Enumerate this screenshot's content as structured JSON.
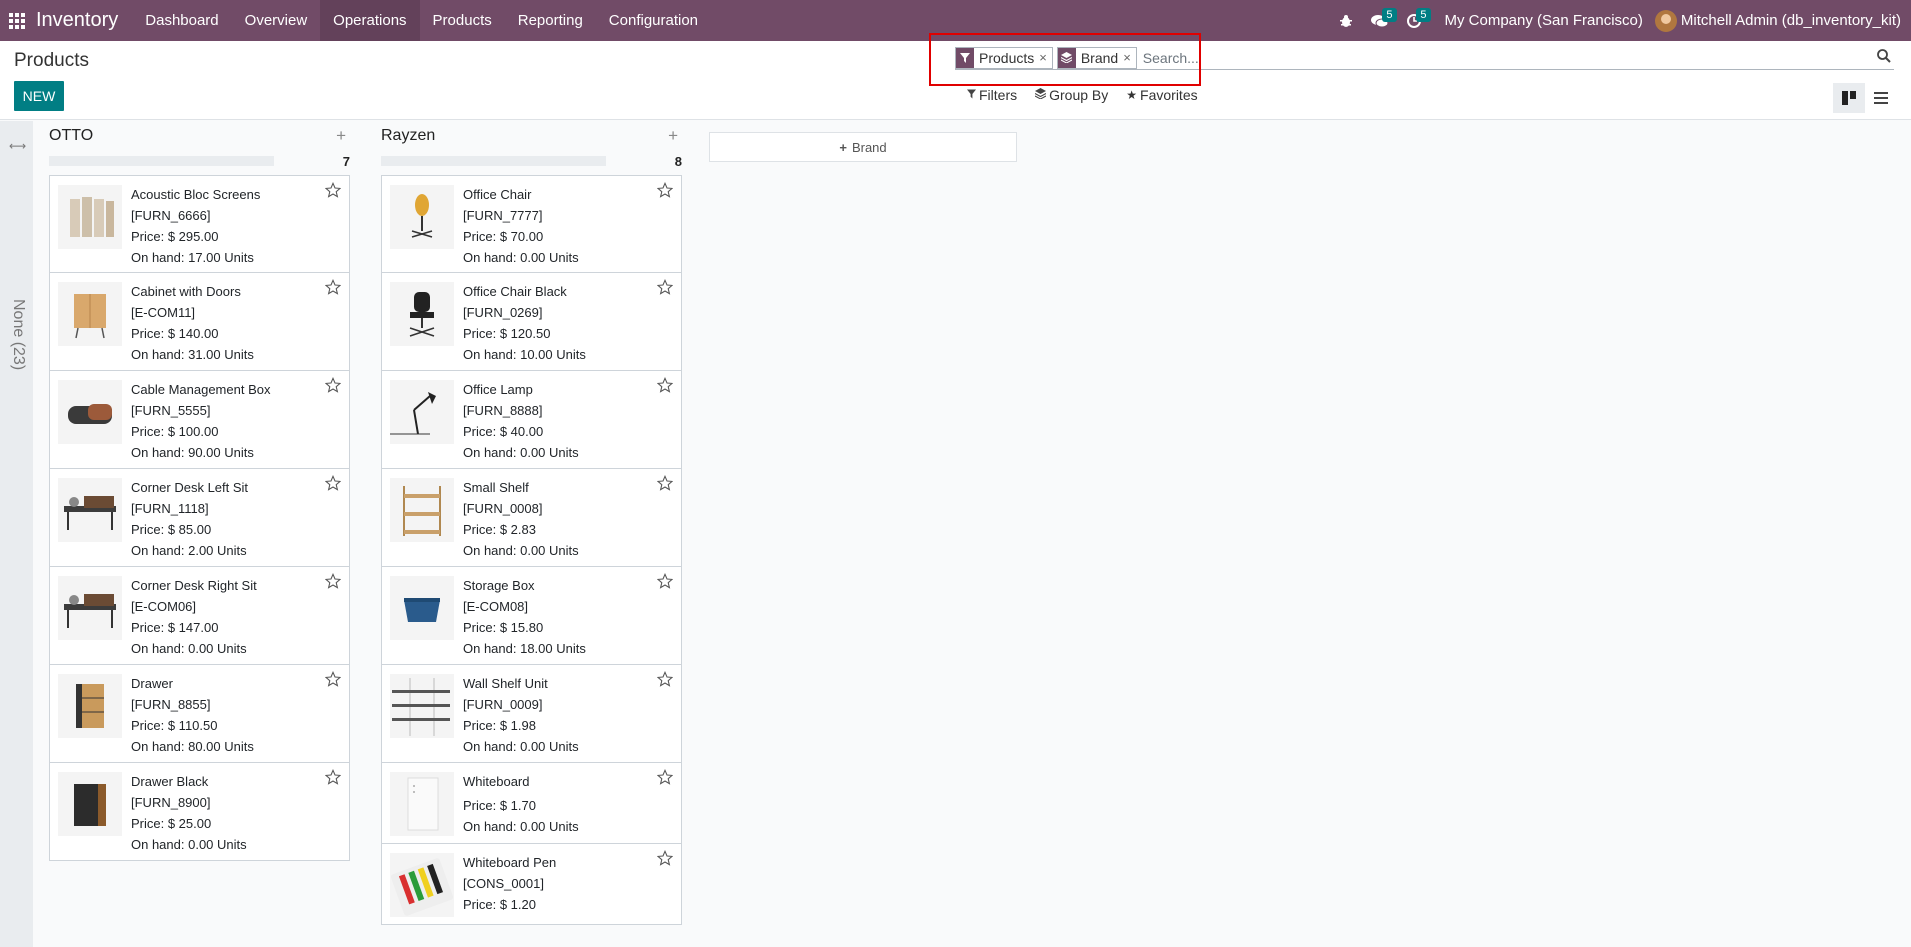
{
  "navbar": {
    "app_name": "Inventory",
    "menu": [
      "Dashboard",
      "Overview",
      "Operations",
      "Products",
      "Reporting",
      "Configuration"
    ],
    "active_menu": "Operations",
    "messages_count": "5",
    "activities_count": "5",
    "company": "My Company (San Francisco)",
    "user": "Mitchell Admin (db_inventory_kit)"
  },
  "control": {
    "title": "Products",
    "new_label": "NEW",
    "facets": [
      {
        "label": "Products",
        "icon": "filter-icon"
      },
      {
        "label": "Brand",
        "icon": "layers-icon"
      }
    ],
    "search_placeholder": "Search...",
    "filters_label": "Filters",
    "group_by_label": "Group By",
    "favorites_label": "Favorites"
  },
  "folded_column": {
    "label": "None (23)"
  },
  "add_column_label": "Brand",
  "columns": [
    {
      "name": "OTTO",
      "count": "7",
      "cards": [
        {
          "name": "Acoustic Bloc Screens",
          "ref": "[FURN_6666]",
          "price": "Price: $ 295.00",
          "onhand": "On hand: 17.00 Units",
          "img": "screens"
        },
        {
          "name": "Cabinet with Doors",
          "ref": "[E-COM11]",
          "price": "Price: $ 140.00",
          "onhand": "On hand: 31.00 Units",
          "img": "cabinet"
        },
        {
          "name": "Cable Management Box",
          "ref": "[FURN_5555]",
          "price": "Price: $ 100.00",
          "onhand": "On hand: 90.00 Units",
          "img": "cablebox"
        },
        {
          "name": "Corner Desk Left Sit",
          "ref": "[FURN_1118]",
          "price": "Price: $ 85.00",
          "onhand": "On hand: 2.00 Units",
          "img": "desk"
        },
        {
          "name": "Corner Desk Right Sit",
          "ref": "[E-COM06]",
          "price": "Price: $ 147.00",
          "onhand": "On hand: 0.00 Units",
          "img": "desk"
        },
        {
          "name": "Drawer",
          "ref": "[FURN_8855]",
          "price": "Price: $ 110.50",
          "onhand": "On hand: 80.00 Units",
          "img": "drawer"
        },
        {
          "name": "Drawer Black",
          "ref": "[FURN_8900]",
          "price": "Price: $ 25.00",
          "onhand": "On hand: 0.00 Units",
          "img": "drawerblack"
        }
      ]
    },
    {
      "name": "Rayzen",
      "count": "8",
      "cards": [
        {
          "name": "Office Chair",
          "ref": "[FURN_7777]",
          "price": "Price: $ 70.00",
          "onhand": "On hand: 0.00 Units",
          "img": "chair"
        },
        {
          "name": "Office Chair Black",
          "ref": "[FURN_0269]",
          "price": "Price: $ 120.50",
          "onhand": "On hand: 10.00 Units",
          "img": "chairblack"
        },
        {
          "name": "Office Lamp",
          "ref": "[FURN_8888]",
          "price": "Price: $ 40.00",
          "onhand": "On hand: 0.00 Units",
          "img": "lamp"
        },
        {
          "name": "Small Shelf",
          "ref": "[FURN_0008]",
          "price": "Price: $ 2.83",
          "onhand": "On hand: 0.00 Units",
          "img": "shelf"
        },
        {
          "name": "Storage Box",
          "ref": "[E-COM08]",
          "price": "Price: $ 15.80",
          "onhand": "On hand: 18.00 Units",
          "img": "storagebox"
        },
        {
          "name": "Wall Shelf Unit",
          "ref": "[FURN_0009]",
          "price": "Price: $ 1.98",
          "onhand": "On hand: 0.00 Units",
          "img": "wallshelf"
        },
        {
          "name": "Whiteboard",
          "price": "Price: $ 1.70",
          "onhand": "On hand: 0.00 Units",
          "img": "whiteboard"
        },
        {
          "name": "Whiteboard Pen",
          "ref": "[CONS_0001]",
          "price": "Price: $ 1.20",
          "img": "pens"
        }
      ]
    }
  ]
}
